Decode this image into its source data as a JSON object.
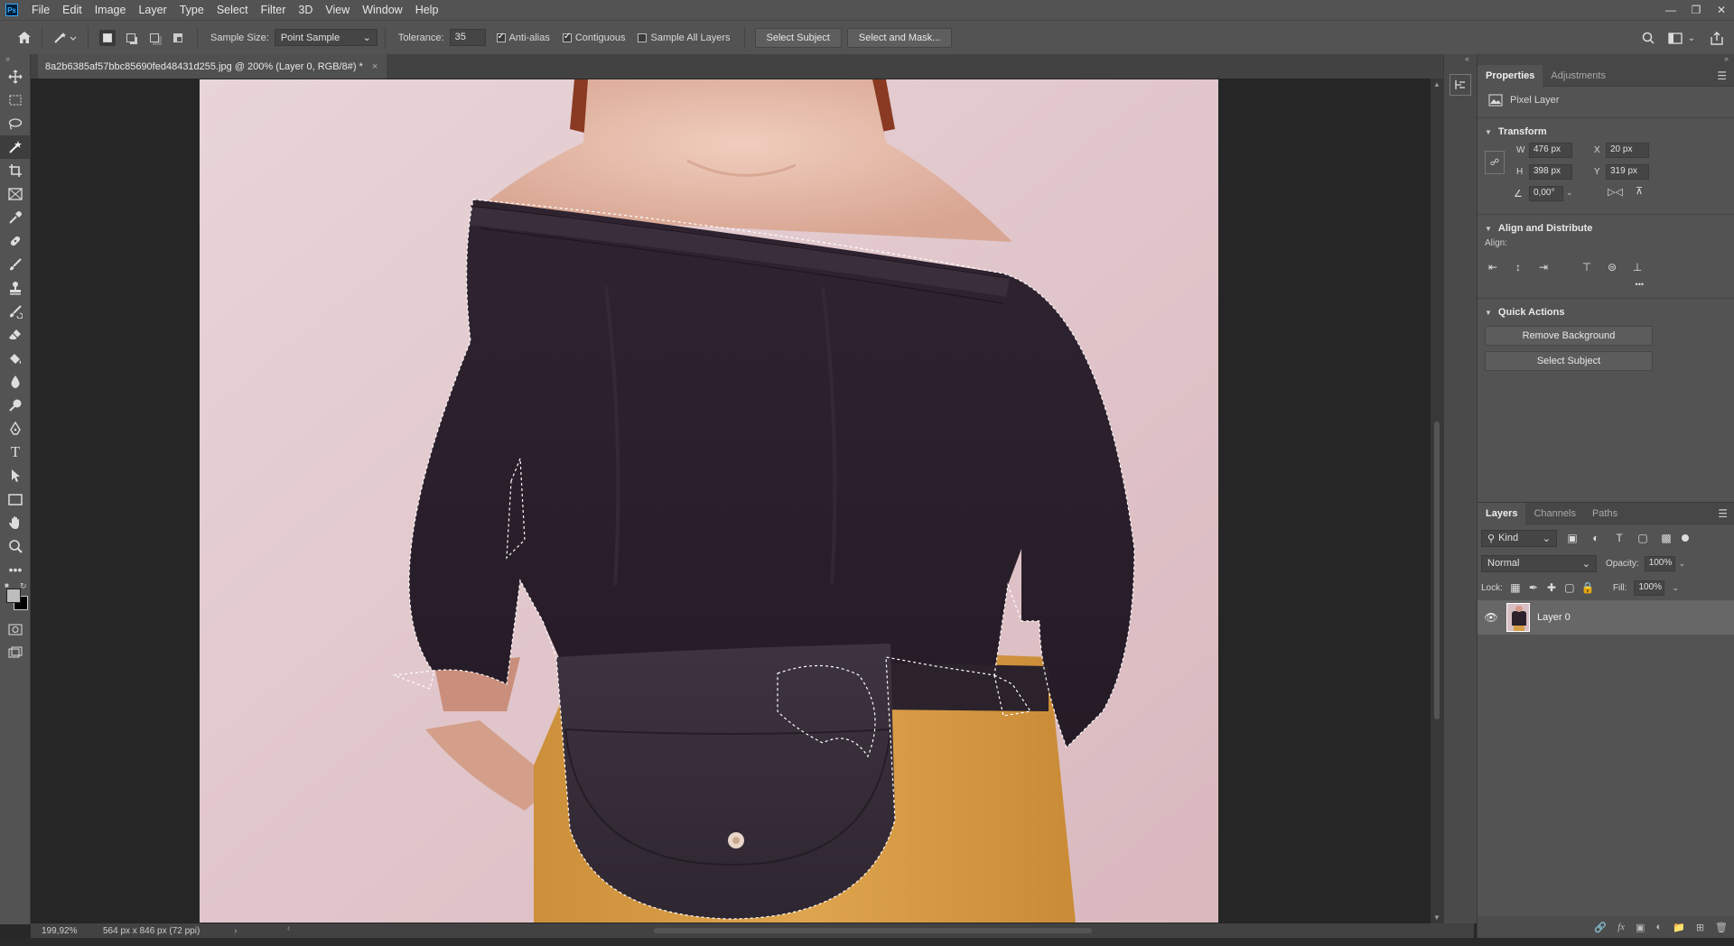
{
  "menubar": {
    "logo": "Ps",
    "items": [
      "File",
      "Edit",
      "Image",
      "Layer",
      "Type",
      "Select",
      "Filter",
      "3D",
      "View",
      "Window",
      "Help"
    ]
  },
  "options": {
    "sample_size_label": "Sample Size:",
    "sample_size_value": "Point Sample",
    "tolerance_label": "Tolerance:",
    "tolerance_value": "35",
    "anti_alias_label": "Anti-alias",
    "contiguous_label": "Contiguous",
    "sample_all_layers_label": "Sample All Layers",
    "select_subject_label": "Select Subject",
    "select_and_mask_label": "Select and Mask..."
  },
  "document": {
    "tab_title": "8a2b6385af57bbc85690fed48431d255.jpg @ 200% (Layer 0, RGB/8#) *",
    "close_glyph": "×"
  },
  "status": {
    "zoom": "199,92%",
    "doc_info": "564 px x 846 px (72 ppi)"
  },
  "properties": {
    "tabs": [
      "Properties",
      "Adjustments"
    ],
    "layer_type": "Pixel Layer",
    "transform_title": "Transform",
    "w_label": "W",
    "w_value": "476 px",
    "h_label": "H",
    "h_value": "398 px",
    "x_label": "X",
    "x_value": "20 px",
    "y_label": "Y",
    "y_value": "319 px",
    "angle_value": "0,00°",
    "align_title": "Align and Distribute",
    "align_label": "Align:",
    "more_glyph": "•••",
    "quick_actions_title": "Quick Actions",
    "remove_background_label": "Remove Background",
    "select_subject_label": "Select Subject"
  },
  "layers": {
    "tabs": [
      "Layers",
      "Channels",
      "Paths"
    ],
    "filter_kind": "Kind",
    "blend_mode": "Normal",
    "opacity_label": "Opacity:",
    "opacity_value": "100%",
    "lock_label": "Lock:",
    "fill_label": "Fill:",
    "fill_value": "100%",
    "items": [
      {
        "name": "Layer 0",
        "visible": true
      }
    ]
  },
  "colors": {
    "foreground": "#bdbdbd",
    "background": "#000000",
    "selection": "#ffffff",
    "accent": "#31a8ff"
  }
}
